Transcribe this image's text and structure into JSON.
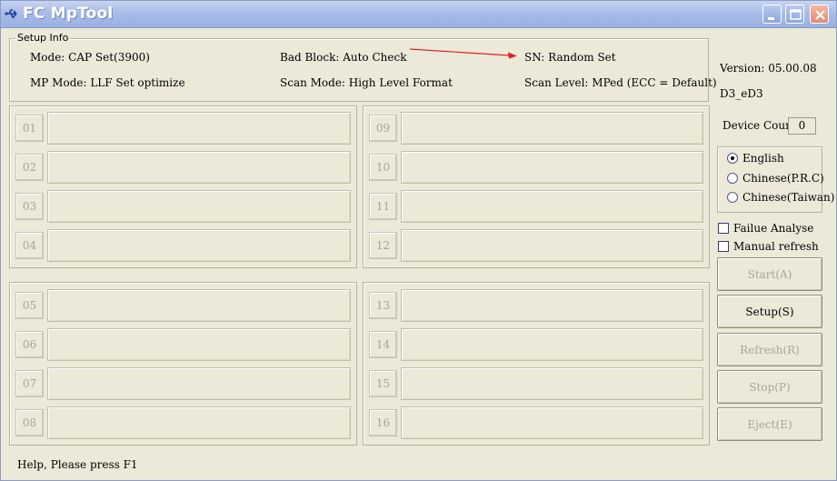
{
  "window": {
    "title": "FC MpTool"
  },
  "setup_info": {
    "legend": "Setup Info",
    "mode": "Mode: CAP Set(3900)",
    "bad_block": "Bad Block: Auto Check",
    "sn": "SN: Random Set",
    "mp_mode": "MP Mode: LLF Set optimize",
    "scan_mode": "Scan Mode: High Level Format",
    "scan_level": "Scan Level: MPed (ECC = Default)",
    "annotation_arrow_color": "#e02020"
  },
  "slots": {
    "group_a": [
      "01",
      "02",
      "03",
      "04"
    ],
    "group_b": [
      "09",
      "10",
      "11",
      "12"
    ],
    "group_c": [
      "05",
      "06",
      "07",
      "08"
    ],
    "group_d": [
      "13",
      "14",
      "15",
      "16"
    ]
  },
  "side": {
    "version": "Version: 05.00.08",
    "build": "D3_eD3",
    "device_count_label": "Device Count:",
    "device_count_value": "0",
    "languages": [
      {
        "label": "English",
        "checked": true
      },
      {
        "label": "Chinese(P.R.C)",
        "checked": false
      },
      {
        "label": "Chinese(Taiwan)",
        "checked": false
      }
    ],
    "fail_analyse": "Failue Analyse",
    "manual_refresh": "Manual refresh",
    "buttons": {
      "start": "Start(A)",
      "setup": "Setup(S)",
      "refresh": "Refresh(R)",
      "stop": "Stop(P)",
      "eject": "Eject(E)"
    }
  },
  "status": {
    "help": "Help, Please press F1"
  },
  "icons": {
    "app": "usb-icon",
    "minimize": "minimize-icon",
    "maximize": "maximize-icon",
    "close": "close-icon"
  }
}
